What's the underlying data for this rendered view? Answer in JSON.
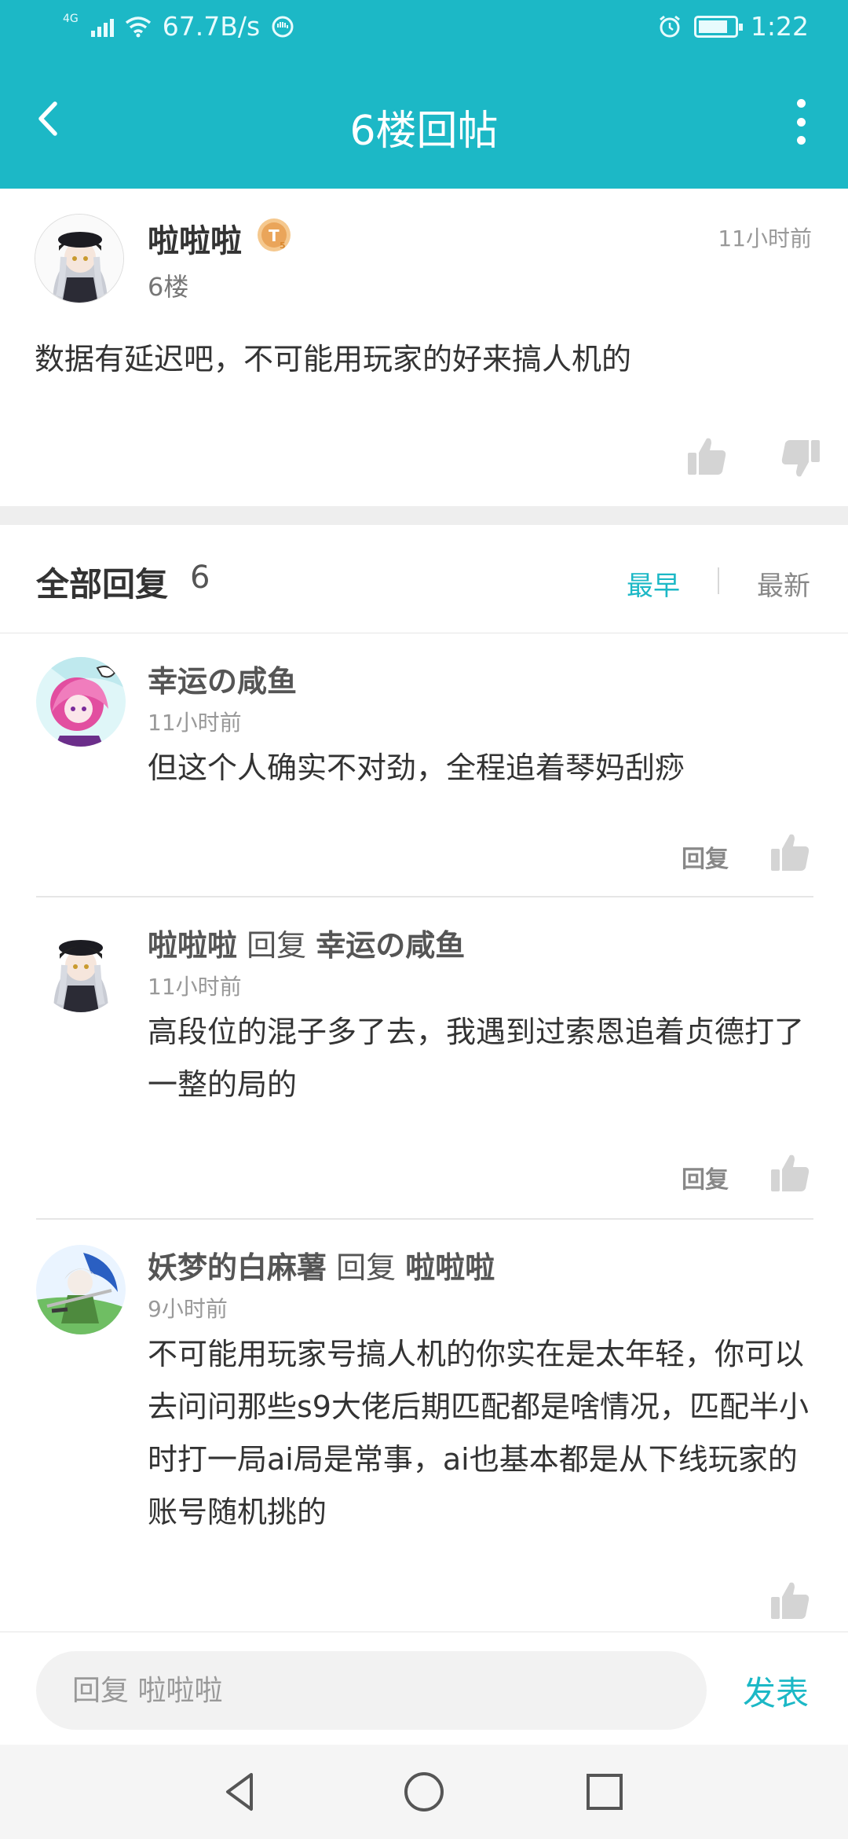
{
  "status_bar": {
    "network_type": "4G",
    "speed": "67.7B/s",
    "time": "1:22",
    "icons": [
      "signal-icon",
      "wifi-icon",
      "vpn-icon",
      "alarm-icon",
      "battery-icon"
    ]
  },
  "header": {
    "title": "6楼回帖",
    "back_icon": "chevron-left-icon",
    "more_icon": "more-vertical-icon",
    "color": "#1cb8c6"
  },
  "post": {
    "author": "啦啦啦",
    "badge": "T5",
    "floor": "6楼",
    "time": "11小时前",
    "content": "数据有延迟吧，不可能用玩家的好来搞人机的"
  },
  "replies_header": {
    "title": "全部回复",
    "count": "6",
    "sort_earliest": "最早",
    "sort_latest": "最新"
  },
  "replies": [
    {
      "author": "幸运の咸鱼",
      "reply_word": "",
      "target": "",
      "time": "11小时前",
      "content": "但这个人确实不对劲，全程追着琴妈刮痧",
      "reply_label": "回复"
    },
    {
      "author": "啦啦啦",
      "reply_word": "回复",
      "target": "幸运の咸鱼",
      "time": "11小时前",
      "content": "高段位的混子多了去，我遇到过索恩追着贞德打了一整的局的",
      "reply_label": "回复"
    },
    {
      "author": "妖梦的白麻薯",
      "reply_word": "回复",
      "target": "啦啦啦",
      "time": "9小时前",
      "content": "不可能用玩家号搞人机的你实在是太年轻，你可以去问问那些s9大佬后期匹配都是啥情况，匹配半小时打一局ai局是常事，ai也基本都是从下线玩家的账号随机挑的"
    }
  ],
  "composer": {
    "placeholder": "回复 啦啦啦",
    "send_label": "发表"
  },
  "nav": {
    "icons": [
      "back-triangle-icon",
      "home-circle-icon",
      "recents-square-icon"
    ]
  }
}
